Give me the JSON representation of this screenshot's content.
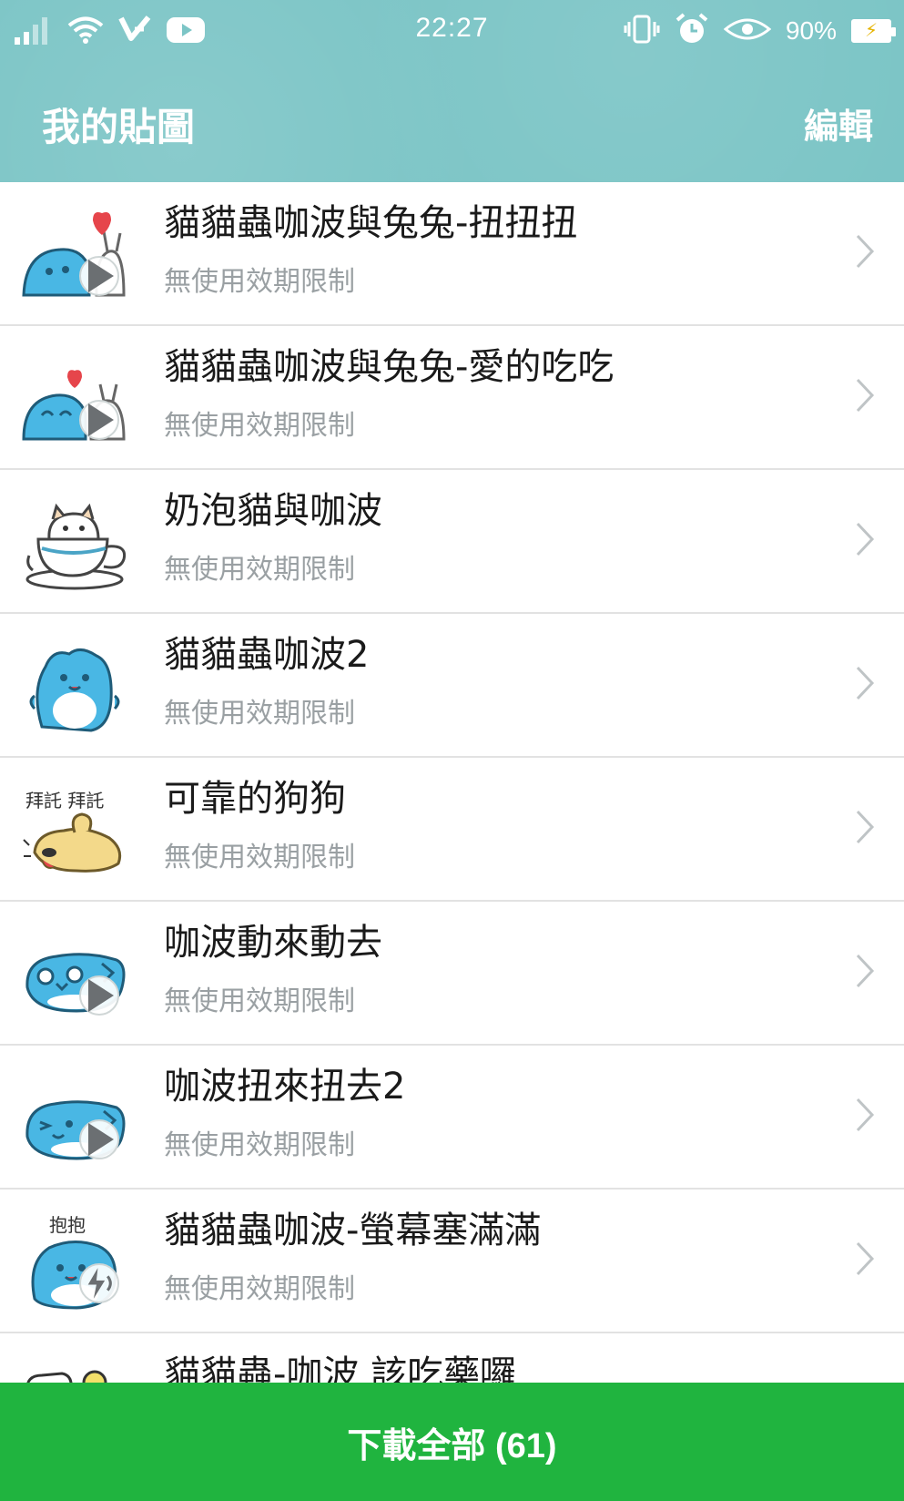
{
  "status_bar": {
    "time": "22:27",
    "battery_percent": "90%",
    "icons_left": [
      "signal-icon",
      "wifi-icon",
      "check-app-icon",
      "youtube-icon"
    ],
    "icons_right": [
      "vibrate-icon",
      "alarm-icon",
      "eye-icon",
      "battery-icon"
    ]
  },
  "header": {
    "title": "我的貼圖",
    "edit_label": "編輯"
  },
  "colors": {
    "header_bg": "#7cc5c6",
    "download_bg": "#20b43f",
    "title_text": "#1a1a1a",
    "subtitle_text": "#9aa0a3"
  },
  "stickers": [
    {
      "title": "貓貓蟲咖波與兔兔-扭扭扭",
      "subtitle": "無使用效期限制",
      "badge": "play",
      "thumb_icon": "capoo-bunny-heart-icon"
    },
    {
      "title": "貓貓蟲咖波與兔兔-愛的吃吃",
      "subtitle": "無使用效期限制",
      "badge": "play",
      "thumb_icon": "capoo-bunny-love-icon"
    },
    {
      "title": "奶泡貓與咖波",
      "subtitle": "無使用效期限制",
      "badge": "none",
      "thumb_icon": "cat-in-cup-icon"
    },
    {
      "title": "貓貓蟲咖波2",
      "subtitle": "無使用效期限制",
      "badge": "none",
      "thumb_icon": "capoo-standing-icon"
    },
    {
      "title": "可靠的狗狗",
      "subtitle": "無使用效期限制",
      "badge": "none",
      "thumb_icon": "dog-begging-icon",
      "thumb_text": "拜託 拜託"
    },
    {
      "title": "咖波動來動去",
      "subtitle": "無使用效期限制",
      "badge": "play",
      "thumb_icon": "capoo-crying-icon"
    },
    {
      "title": "咖波扭來扭去2",
      "subtitle": "無使用效期限制",
      "badge": "play",
      "thumb_icon": "capoo-winking-icon"
    },
    {
      "title": "貓貓蟲咖波-螢幕塞滿滿",
      "subtitle": "無使用效期限制",
      "badge": "sound",
      "thumb_icon": "capoo-hug-icon",
      "thumb_text": "抱抱"
    },
    {
      "title": "貓貓蟲-咖波 該吃藥囉",
      "subtitle": "",
      "badge": "none",
      "thumb_icon": "capoo-medicine-icon"
    }
  ],
  "footer": {
    "download_all_label": "下載全部 (61)"
  }
}
